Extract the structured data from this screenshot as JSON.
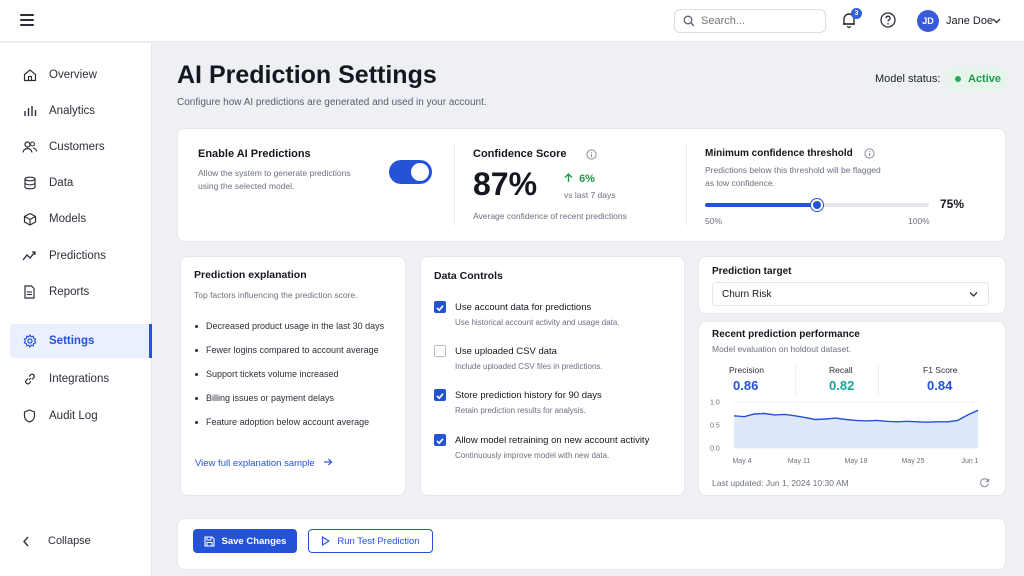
{
  "topbar": {
    "search_placeholder": "Search...",
    "notification_count": "3",
    "user": {
      "initials": "JD",
      "name": "Jane Doe"
    }
  },
  "sidebar": {
    "items": [
      {
        "label": "Overview",
        "icon": "home-icon"
      },
      {
        "label": "Analytics",
        "icon": "bar-chart-icon"
      },
      {
        "label": "Customers",
        "icon": "users-icon"
      },
      {
        "label": "Data",
        "icon": "database-icon"
      },
      {
        "label": "Models",
        "icon": "cube-icon"
      },
      {
        "label": "Predictions",
        "icon": "trend-icon"
      },
      {
        "label": "Reports",
        "icon": "document-icon"
      },
      {
        "label": "Settings",
        "icon": "gear-icon",
        "active": true
      },
      {
        "label": "Integrations",
        "icon": "link-icon"
      },
      {
        "label": "Audit Log",
        "icon": "shield-icon"
      }
    ],
    "collapse_label": "Collapse"
  },
  "page": {
    "title": "AI Prediction Settings",
    "subtitle": "Configure how AI predictions are generated and used in your account.",
    "model_status_label": "Model status:",
    "model_status_value": "Active"
  },
  "enable": {
    "title": "Enable AI Predictions",
    "description_line1": "Allow the system to generate predictions",
    "description_line2": "using the selected model.",
    "enabled": true
  },
  "confidence": {
    "title": "Confidence Score",
    "value": "87%",
    "trend": "6%",
    "trend_sub": "vs last 7 days",
    "caption": "Average confidence of recent predictions"
  },
  "threshold": {
    "title": "Minimum confidence threshold",
    "description_line1": "Predictions below this threshold will be flagged",
    "description_line2": "as low confidence.",
    "min_label": "50%",
    "max_label": "100%",
    "value_label": "75%",
    "value_fraction": 0.5
  },
  "explanation": {
    "title": "Prediction explanation",
    "subtitle": "Top factors influencing the prediction score.",
    "factors": [
      "Decreased product usage in the last 30 days",
      "Fewer logins compared to account average",
      "Support tickets volume increased",
      "Billing issues or payment delays",
      "Feature adoption below account average"
    ],
    "link": "View full explanation sample"
  },
  "data_controls": {
    "title": "Data Controls",
    "items": [
      {
        "label": "Use account data for predictions",
        "sub": "Use historical account activity and usage data.",
        "checked": true
      },
      {
        "label": "Use uploaded CSV data",
        "sub": "Include uploaded CSV files in predictions.",
        "checked": false
      },
      {
        "label": "Store prediction history for 90 days",
        "sub": "Retain prediction results for analysis.",
        "checked": true
      },
      {
        "label": "Allow model retraining on new account activity",
        "sub": "Continuously improve model with new data.",
        "checked": true
      }
    ]
  },
  "target": {
    "title": "Prediction target",
    "selected": "Churn Risk"
  },
  "performance": {
    "title": "Recent prediction performance",
    "subtitle": "Model evaluation on holdout dataset.",
    "metrics": [
      {
        "label": "Precision",
        "value": "0.86",
        "color": "#2453d6"
      },
      {
        "label": "Recall",
        "value": "0.82",
        "color": "#1aa39a"
      },
      {
        "label": "F1 Score",
        "value": "0.84",
        "color": "#2453d6"
      }
    ],
    "last_updated": "Last updated: Jun 1, 2024 10:30 AM"
  },
  "chart_data": {
    "type": "area",
    "x": [
      "May 4",
      "May 11",
      "May 18",
      "May 25",
      "Jun 1"
    ],
    "yticks": [
      "1.0",
      "0.5",
      "0.0"
    ],
    "ylim": [
      0,
      1
    ],
    "series": [
      {
        "values": [
          0.7,
          0.68,
          0.74,
          0.75,
          0.72,
          0.73,
          0.7,
          0.66,
          0.62,
          0.63,
          0.65,
          0.62,
          0.6,
          0.59,
          0.6,
          0.58,
          0.57,
          0.58,
          0.57,
          0.56,
          0.57,
          0.57,
          0.6,
          0.72,
          0.82
        ]
      }
    ],
    "color": "#2453d6"
  },
  "actions": {
    "save": "Save Changes",
    "test": "Run Test Prediction"
  }
}
